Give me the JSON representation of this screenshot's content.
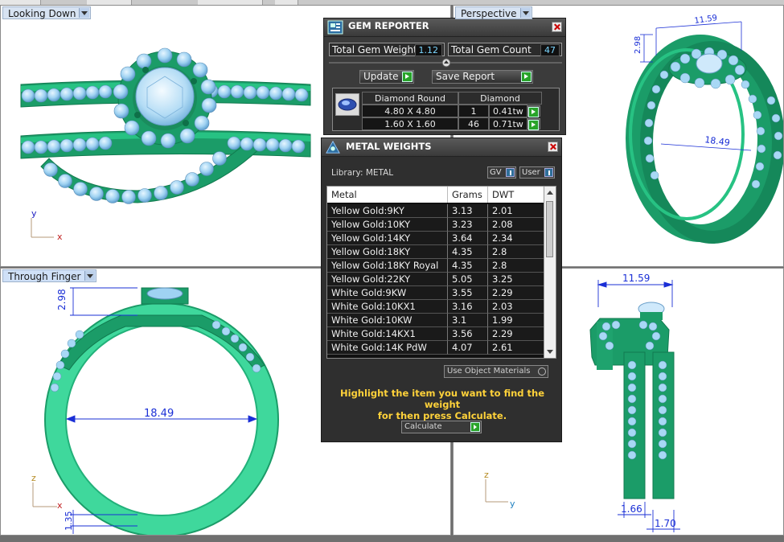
{
  "viewports": {
    "top_left": {
      "title": "Looking Down"
    },
    "top_right": {
      "title": "Perspective"
    },
    "bottom_left": {
      "title": "Through Finger"
    }
  },
  "axes": {
    "x": "x",
    "y": "y",
    "z": "z"
  },
  "dimensions": {
    "head_height": "2.98",
    "inner_diameter": "18.49",
    "shank_thickness": "1.35",
    "width_top": "11.59",
    "band_left": "1.66",
    "band_right": "1.70"
  },
  "gem_reporter": {
    "title": "GEM REPORTER",
    "total_weight_label": "Total Gem Weight",
    "total_weight_value": "1.12",
    "total_count_label": "Total Gem Count",
    "total_count_value": "47",
    "update_label": "Update",
    "save_report_label": "Save Report",
    "table": {
      "col_shape": "Diamond Round",
      "col_material": "Diamond",
      "rows": [
        {
          "size": "4.80 X 4.80",
          "count": "1",
          "weight": "0.41tw"
        },
        {
          "size": "1.60 X 1.60",
          "count": "46",
          "weight": "0.71tw"
        }
      ]
    }
  },
  "metal_weights": {
    "title": "METAL WEIGHTS",
    "library_label": "Library: METAL",
    "gv_label": "GV",
    "user_label": "User",
    "columns": {
      "metal": "Metal",
      "grams": "Grams",
      "dwt": "DWT"
    },
    "rows": [
      {
        "metal": "Yellow Gold:9KY",
        "grams": "3.13",
        "dwt": "2.01"
      },
      {
        "metal": "Yellow Gold:10KY",
        "grams": "3.23",
        "dwt": "2.08"
      },
      {
        "metal": "Yellow Gold:14KY",
        "grams": "3.64",
        "dwt": "2.34"
      },
      {
        "metal": "Yellow Gold:18KY",
        "grams": "4.35",
        "dwt": "2.8"
      },
      {
        "metal": "Yellow Gold:18KY Royal",
        "grams": "4.35",
        "dwt": "2.8"
      },
      {
        "metal": "Yellow Gold:22KY",
        "grams": "5.05",
        "dwt": "3.25"
      },
      {
        "metal": "White Gold:9KW",
        "grams": "3.55",
        "dwt": "2.29"
      },
      {
        "metal": "White Gold:10KX1",
        "grams": "3.16",
        "dwt": "2.03"
      },
      {
        "metal": "White Gold:10KW",
        "grams": "3.1",
        "dwt": "1.99"
      },
      {
        "metal": "White Gold:14KX1",
        "grams": "3.56",
        "dwt": "2.29"
      },
      {
        "metal": "White Gold:14K PdW",
        "grams": "4.07",
        "dwt": "2.61"
      }
    ],
    "use_object_materials_label": "Use Object Materials",
    "hint_line1": "Highlight the item you want to find the weight",
    "hint_line2": "for then press Calculate.",
    "calculate_label": "Calculate"
  },
  "colors": {
    "metal_green": "#1fa36e",
    "metal_light": "#4ee0a8",
    "gem_blue": "#a8d8f5",
    "dim_blue": "#1a2fd6"
  }
}
